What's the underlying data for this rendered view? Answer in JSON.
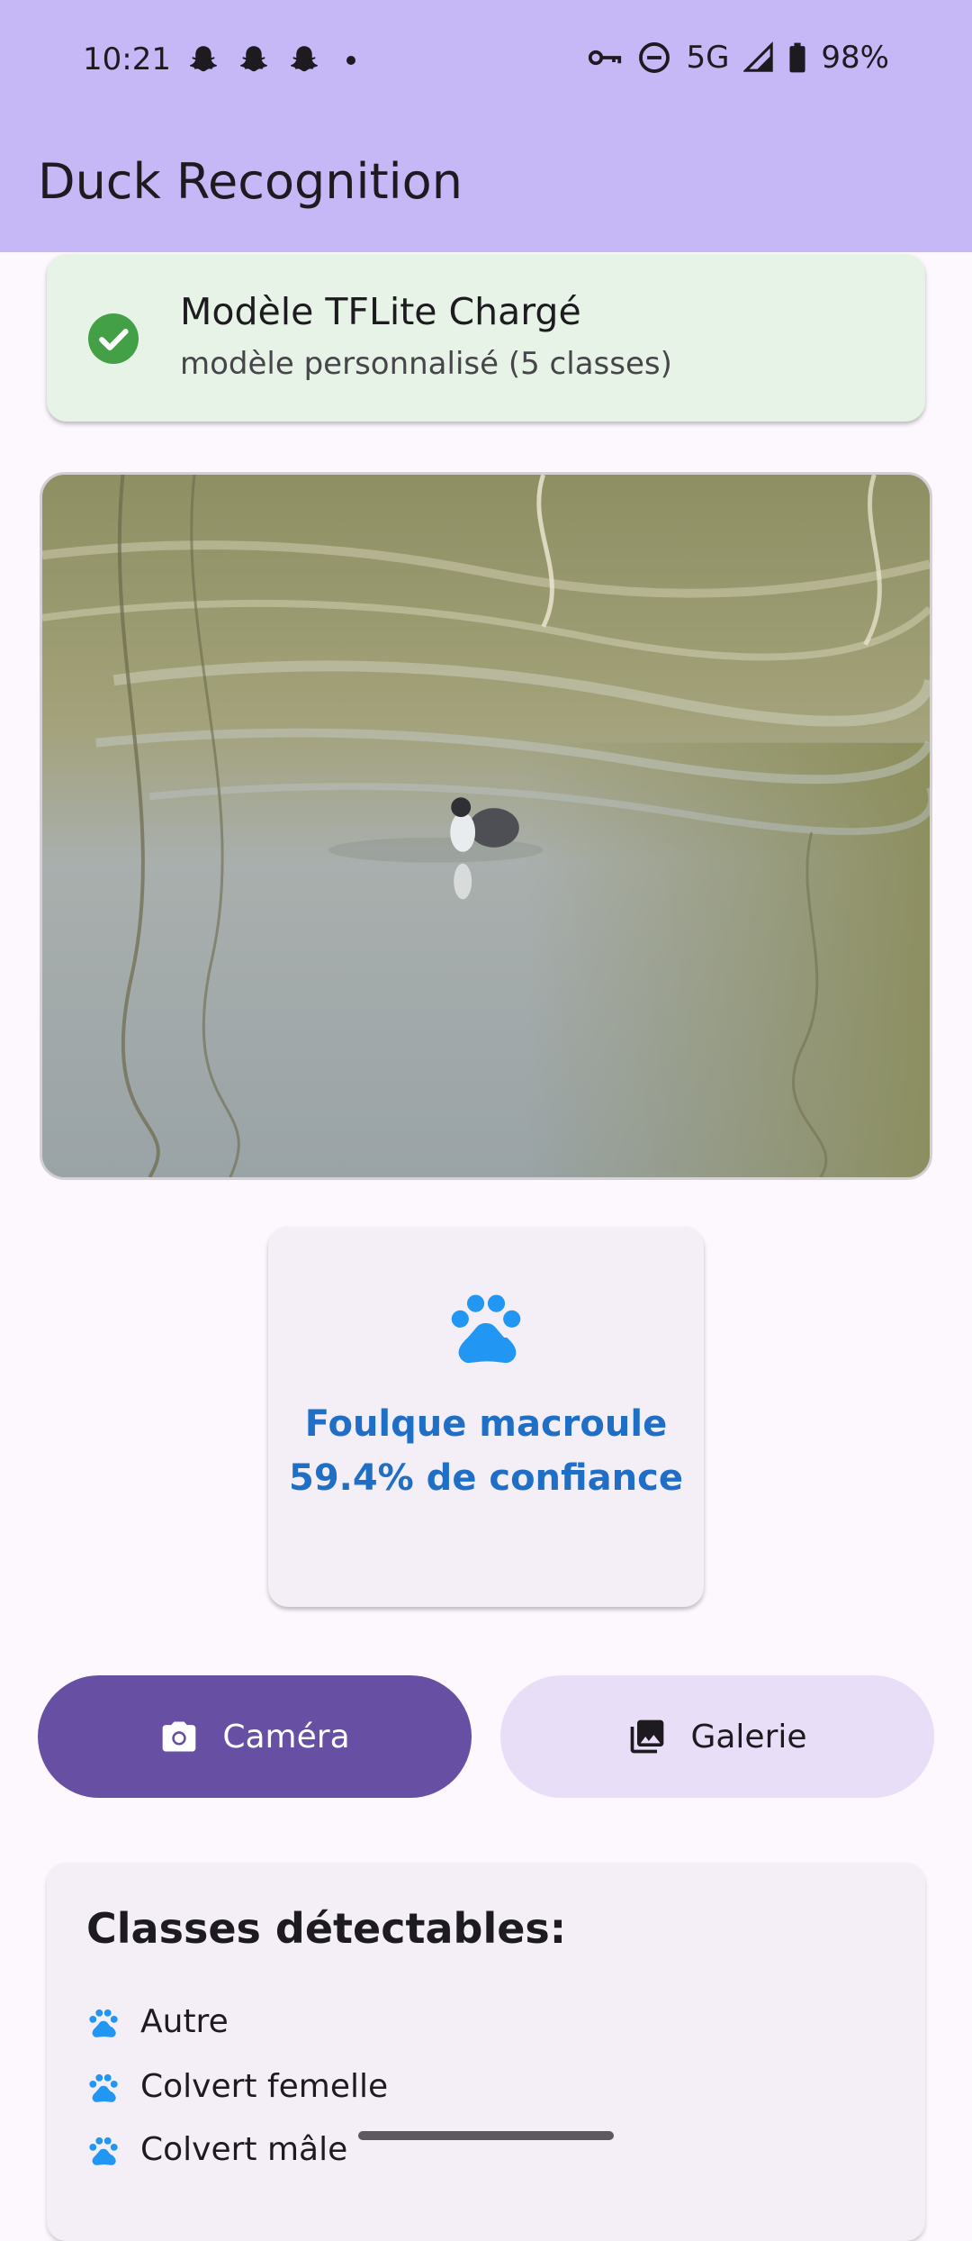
{
  "status_bar": {
    "time": "10:21",
    "left_icons": [
      "snapchat-icon",
      "snapchat-icon",
      "snapchat-icon",
      "dot-icon"
    ],
    "right_icons": [
      "vpn-key-icon",
      "do-not-disturb-icon",
      "signal-icon",
      "battery-icon"
    ],
    "network": "5G",
    "battery": "98%"
  },
  "app_bar": {
    "title": "Duck Recognition"
  },
  "model_status": {
    "title": "Modèle TFLite Chargé",
    "subtitle": "modèle personnalisé (5 classes)",
    "icon": "check-circle-icon",
    "color": "#43a047"
  },
  "result": {
    "icon": "paw-icon",
    "label": "Foulque macroule",
    "confidence": "59.4% de confiance",
    "color": "#1f6fc6"
  },
  "buttons": {
    "camera": {
      "label": "Caméra",
      "icon": "camera-icon"
    },
    "gallery": {
      "label": "Galerie",
      "icon": "photo-library-icon"
    }
  },
  "classes": {
    "title": "Classes détectables:",
    "items": [
      "Autre",
      "Colvert femelle",
      "Colvert mâle"
    ]
  },
  "colors": {
    "app_bar": "#c6b7f7",
    "primary": "#6750a4",
    "secondary_container": "#e8def8",
    "accent_blue": "#1f6fc6"
  }
}
